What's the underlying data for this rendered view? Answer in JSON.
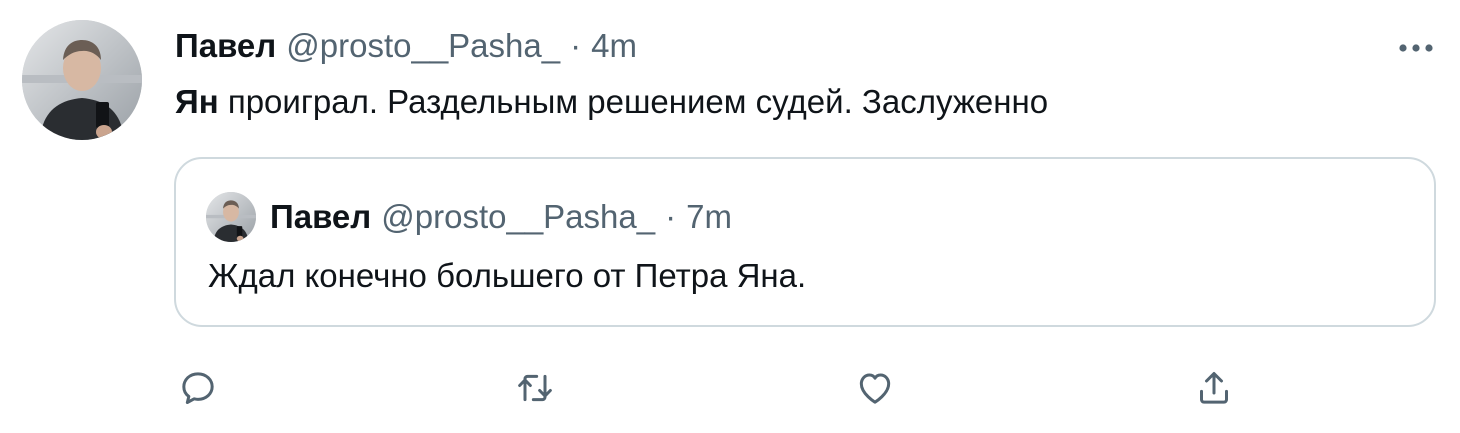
{
  "tweet": {
    "author": {
      "name": "Павел",
      "handle": "@prosto__Pasha_",
      "separator": "·",
      "time": "4m",
      "avatar_icon": "user-photo-avatar"
    },
    "text": {
      "mention": "Ян",
      "rest": " проиграл. Раздельным решением судей. Заслуженно"
    },
    "more_icon": "more-horizontal-icon"
  },
  "quoted_tweet": {
    "author": {
      "name": "Павел",
      "handle": "@prosto__Pasha_",
      "separator": "·",
      "time": "7m",
      "avatar_icon": "user-photo-avatar"
    },
    "text": "Ждал конечно большего от Петра Яна."
  },
  "actions": [
    {
      "icon": "reply-icon"
    },
    {
      "icon": "retweet-icon"
    },
    {
      "icon": "like-icon"
    },
    {
      "icon": "share-icon"
    }
  ],
  "colors": {
    "text_primary": "#0f1419",
    "text_secondary": "#536471",
    "border": "#cfd9de"
  }
}
